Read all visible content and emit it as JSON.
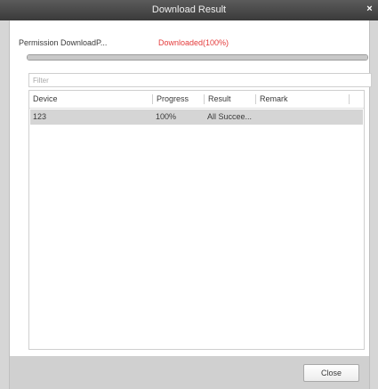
{
  "window": {
    "title": "Download Result",
    "close_glyph": "×"
  },
  "status": {
    "label": "Permission DownloadP...",
    "value": "Downloaded(100%)",
    "progress_percent": 100,
    "value_color": "#e43b3b"
  },
  "filter": {
    "placeholder": "Filter",
    "value": ""
  },
  "table": {
    "columns": [
      "Device",
      "Progress",
      "Result",
      "Remark"
    ],
    "rows": [
      {
        "device": "123",
        "progress": "100%",
        "result": "All Succee...",
        "remark": ""
      }
    ]
  },
  "footer": {
    "close_label": "Close"
  }
}
